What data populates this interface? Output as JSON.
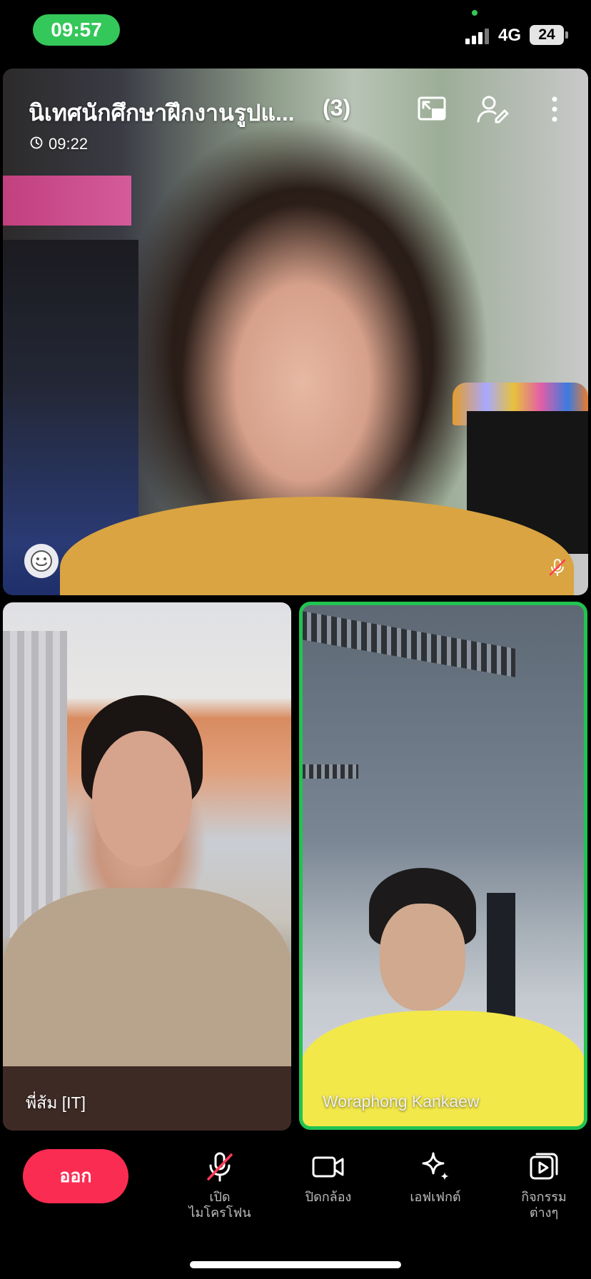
{
  "status_bar": {
    "time": "09:57",
    "network": "4G",
    "battery": "24"
  },
  "call": {
    "title": "นิเทศนักศึกษาฝึกงานรูปแ...",
    "participant_count": "(3)",
    "duration": "09:22"
  },
  "participants": [
    {
      "name": "พี่ส้ม [IT]"
    },
    {
      "name": "Woraphong Kankaew"
    }
  ],
  "controls": {
    "leave_label": "ออก",
    "mic_label_line1": "เปิด",
    "mic_label_line2": "ไมโครโฟน",
    "camera_label": "ปิดกล้อง",
    "effects_label": "เอฟเฟกต์",
    "activities_label_line1": "กิจกรรม",
    "activities_label_line2": "ต่างๆ"
  },
  "colors": {
    "time_pill": "#34c759",
    "active_speaker_border": "#21c351",
    "leave_button": "#fb2c52"
  },
  "icons": [
    "clock-icon",
    "pip-icon",
    "add-participant-icon",
    "more-icon",
    "emoji-icon",
    "mic-off-icon",
    "camera-icon",
    "effects-icon",
    "activities-icon"
  ]
}
